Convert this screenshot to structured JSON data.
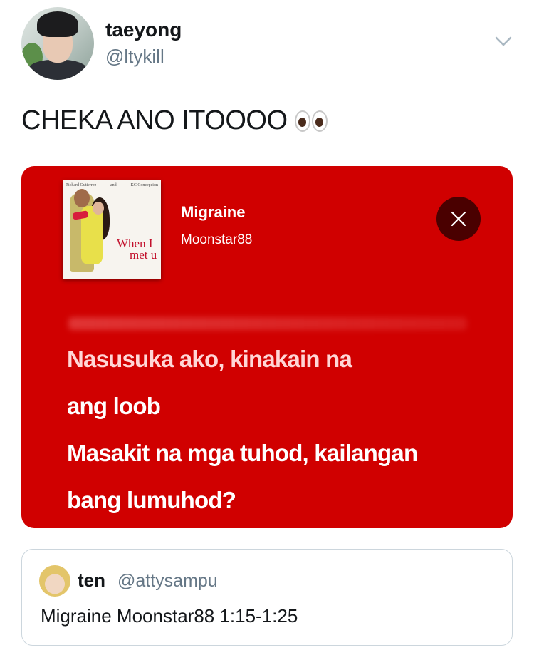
{
  "author": {
    "display_name": "taeyong",
    "handle": "@ltykill"
  },
  "tweet": {
    "text": "CHEKA ANO ITOOOO",
    "emoji": "eyes"
  },
  "lyrics_card": {
    "background_color": "#d00000",
    "cover": {
      "top_left_name": "Richard Gutierrez",
      "connector": "and",
      "top_right_name": "KC Concepcion",
      "title_line1": "When I",
      "title_line2": "met u"
    },
    "song_title": "Migraine",
    "artist": "Moonstar88",
    "close_icon": "close-icon",
    "lyrics": [
      "Nasusuka ako, kinakain na",
      "ang loob",
      "Masakit na mga tuhod, kailangan",
      "bang lumuhod?"
    ]
  },
  "quoted_tweet": {
    "display_name": "ten",
    "handle": "@attysampu",
    "text": "Migraine Moonstar88 1:15-1:25"
  }
}
